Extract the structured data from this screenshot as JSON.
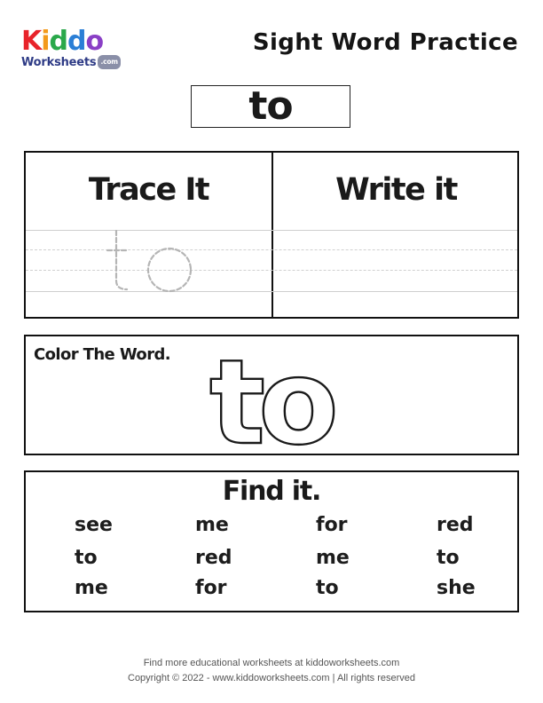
{
  "logo": {
    "letters": [
      {
        "ch": "K",
        "color": "#e8232a"
      },
      {
        "ch": "i",
        "color": "#f39a1c"
      },
      {
        "ch": "d",
        "color": "#2aa84a"
      },
      {
        "ch": "d",
        "color": "#2b7fd6"
      },
      {
        "ch": "o",
        "color": "#8a3fc6"
      }
    ],
    "subtitle": "Worksheets",
    "suffix": ".com"
  },
  "header": {
    "title": "Sight Word Practice"
  },
  "sight_word": "to",
  "trace_panel": {
    "trace_heading": "Trace It",
    "write_heading": "Write it",
    "trace_word": "to"
  },
  "color_panel": {
    "label": "Color The Word.",
    "word": "to"
  },
  "find_panel": {
    "title": "Find it.",
    "rows": [
      [
        "see",
        "me",
        "for",
        "red"
      ],
      [
        "to",
        "red",
        "me",
        "to"
      ],
      [
        "me",
        "for",
        "to",
        "she"
      ]
    ]
  },
  "footer": {
    "line1": "Find more educational worksheets at kiddoworksheets.com",
    "line2": "Copyright © 2022 - www.kiddoworksheets.com  |  All rights reserved"
  },
  "colors": {
    "border": "#111111",
    "guide_line": "#cfcfcf",
    "trace_outline": "#b5b5b5"
  }
}
